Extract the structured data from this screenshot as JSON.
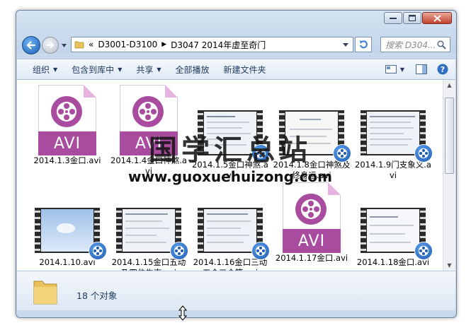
{
  "address": {
    "prefix": "«",
    "crumbs": [
      "D3001-D3100",
      "D3047  2014年虚至奇门"
    ]
  },
  "search": {
    "placeholder": "搜索 D304..."
  },
  "toolbar": {
    "organize": "组织",
    "include_in_library": "包含到库中",
    "share": "共享",
    "play_all": "全部播放",
    "new_folder": "新建文件夹"
  },
  "files": [
    {
      "name": "2014.1.3金口.avi",
      "kind": "avi"
    },
    {
      "name": "2014.1.4金口神煞.avi",
      "kind": "avi"
    },
    {
      "name": "2014.1.5金口神煞.avi",
      "kind": "video"
    },
    {
      "name": "2014.1.8金口神煞及终身运.avi",
      "kind": "video"
    },
    {
      "name": "2014.1.9门支象义.avi",
      "kind": "video"
    },
    {
      "name": "2014.1.10.avi",
      "kind": "video"
    },
    {
      "name": "2014.1.15金口五动及四位生克.avi",
      "kind": "video"
    },
    {
      "name": "2014.1.16金口三动五合三合等.avi",
      "kind": "video"
    },
    {
      "name": "2014.1.17金口.avi",
      "kind": "avi"
    },
    {
      "name": "2014.1.18金口.avi",
      "kind": "video"
    }
  ],
  "avi_label": "AVI",
  "status": {
    "count": "18 个对象"
  },
  "watermark": {
    "cn": "国学汇总站",
    "url": "www.guoxuehuizong.com"
  },
  "colors": {
    "avi_purple": "#a94b9f",
    "window_frame": "#c9d9ec",
    "toolbar_text": "#1e395b"
  }
}
